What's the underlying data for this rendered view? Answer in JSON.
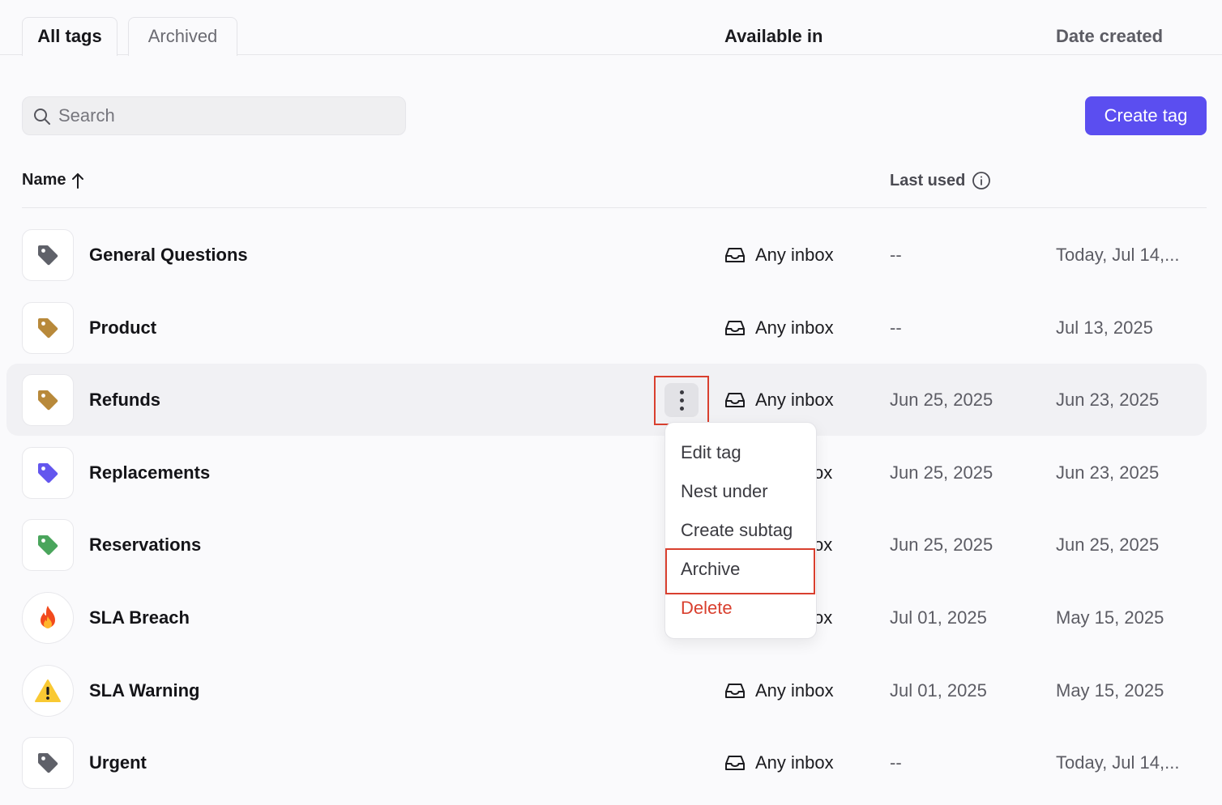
{
  "tabs": [
    {
      "label": "All tags",
      "active": true
    },
    {
      "label": "Archived",
      "active": false
    }
  ],
  "search": {
    "placeholder": "Search",
    "value": ""
  },
  "create_button": "Create tag",
  "columns": {
    "name": "Name",
    "available_in": "Available in",
    "last_used": "Last used",
    "date_created": "Date created"
  },
  "rows": [
    {
      "name": "General Questions",
      "icon": "tag-icon",
      "icon_color": "#5f6169",
      "available_in": "Any inbox",
      "last_used": "--",
      "date_created": "Today, Jul 14,..."
    },
    {
      "name": "Product",
      "icon": "tag-icon",
      "icon_color": "#b8893a",
      "available_in": "Any inbox",
      "last_used": "--",
      "date_created": "Jul 13, 2025"
    },
    {
      "name": "Refunds",
      "icon": "tag-icon",
      "icon_color": "#b8893a",
      "available_in": "Any inbox",
      "last_used": "Jun 25, 2025",
      "date_created": "Jun 23, 2025"
    },
    {
      "name": "Replacements",
      "icon": "tag-icon",
      "icon_color": "#6356ee",
      "available_in": "ox",
      "last_used": "Jun 25, 2025",
      "date_created": "Jun 23, 2025"
    },
    {
      "name": "Reservations",
      "icon": "tag-icon",
      "icon_color": "#4aa55c",
      "available_in": "ox",
      "last_used": "Jun 25, 2025",
      "date_created": "Jun 25, 2025"
    },
    {
      "name": "SLA Breach",
      "icon": "fire-icon",
      "available_in": "ox",
      "last_used": "Jul 01, 2025",
      "date_created": "May 15, 2025"
    },
    {
      "name": "SLA Warning",
      "icon": "warning-icon",
      "available_in": "Any inbox",
      "last_used": "Jul 01, 2025",
      "date_created": "May 15, 2025"
    },
    {
      "name": "Urgent",
      "icon": "tag-icon",
      "icon_color": "#5f6169",
      "available_in": "Any inbox",
      "last_used": "--",
      "date_created": "Today, Jul 14,..."
    }
  ],
  "context_menu": {
    "items": [
      "Edit tag",
      "Nest under",
      "Create subtag",
      "Archive",
      "Delete"
    ]
  },
  "colors": {
    "accent": "#5b4ef0",
    "danger": "#d9402f"
  }
}
